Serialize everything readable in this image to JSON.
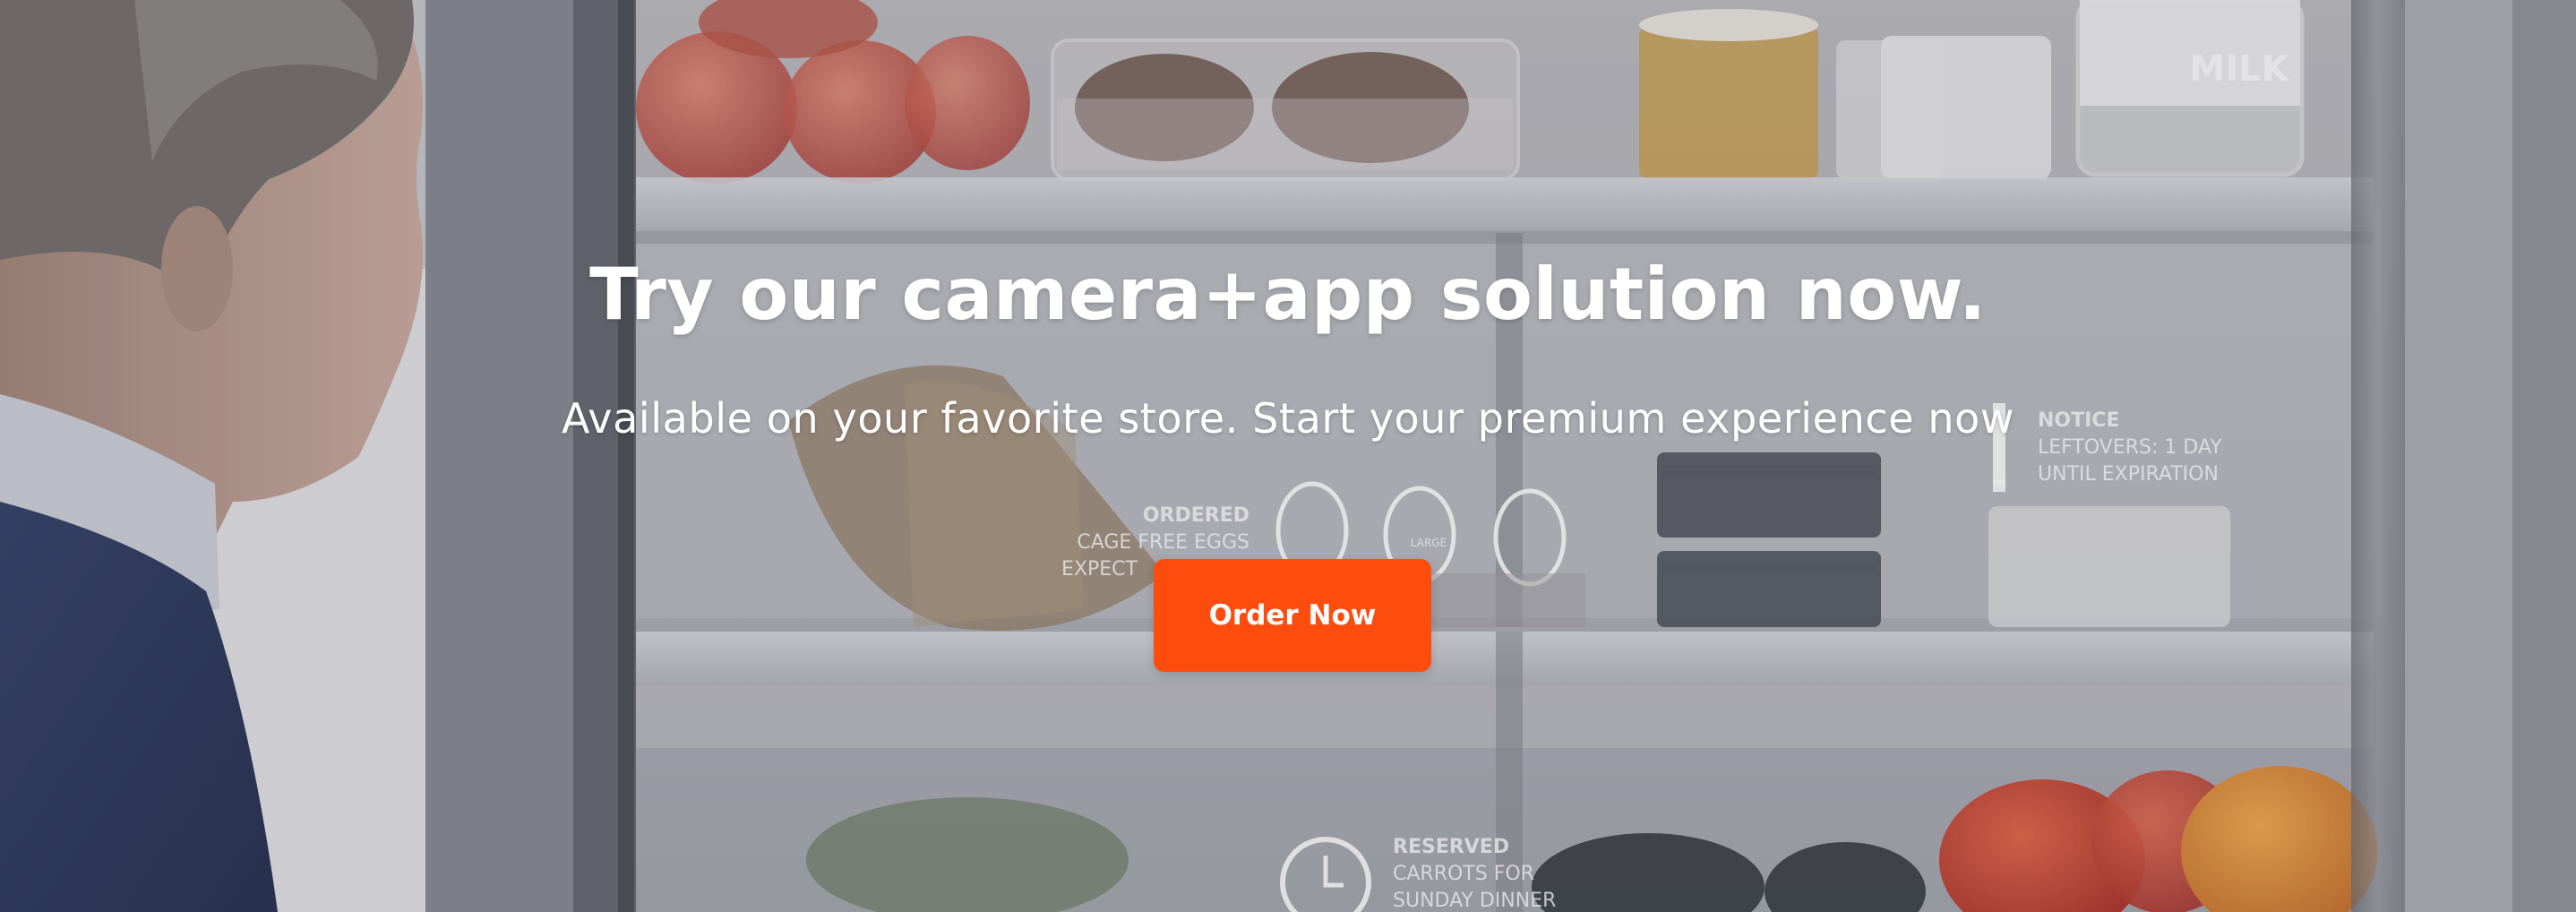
{
  "hero": {
    "title": "Try our camera+app solution now.",
    "subtitle": "Available on your favorite store. Start your premium experience now",
    "cta_label": "Order Now"
  },
  "fridge_overlay": {
    "milk_label": "MILK",
    "ordered_title": "ORDERED",
    "ordered_line1": "CAGE FREE EGGS",
    "ordered_line2": "EXPECT",
    "notice_title": "NOTICE",
    "notice_line1": "LEFTOVERS: 1 DAY",
    "notice_line2": "UNTIL EXPIRATION",
    "reserved_title": "RESERVED",
    "reserved_line1": "CARROTS FOR",
    "reserved_line2": "SUNDAY DINNER",
    "egg_label_large": "LARGE"
  },
  "colors": {
    "accent": "#fc4d0f",
    "text": "#ffffff",
    "sweater": "#1e2c52",
    "fridge_shelf": "#c9cbd0"
  }
}
